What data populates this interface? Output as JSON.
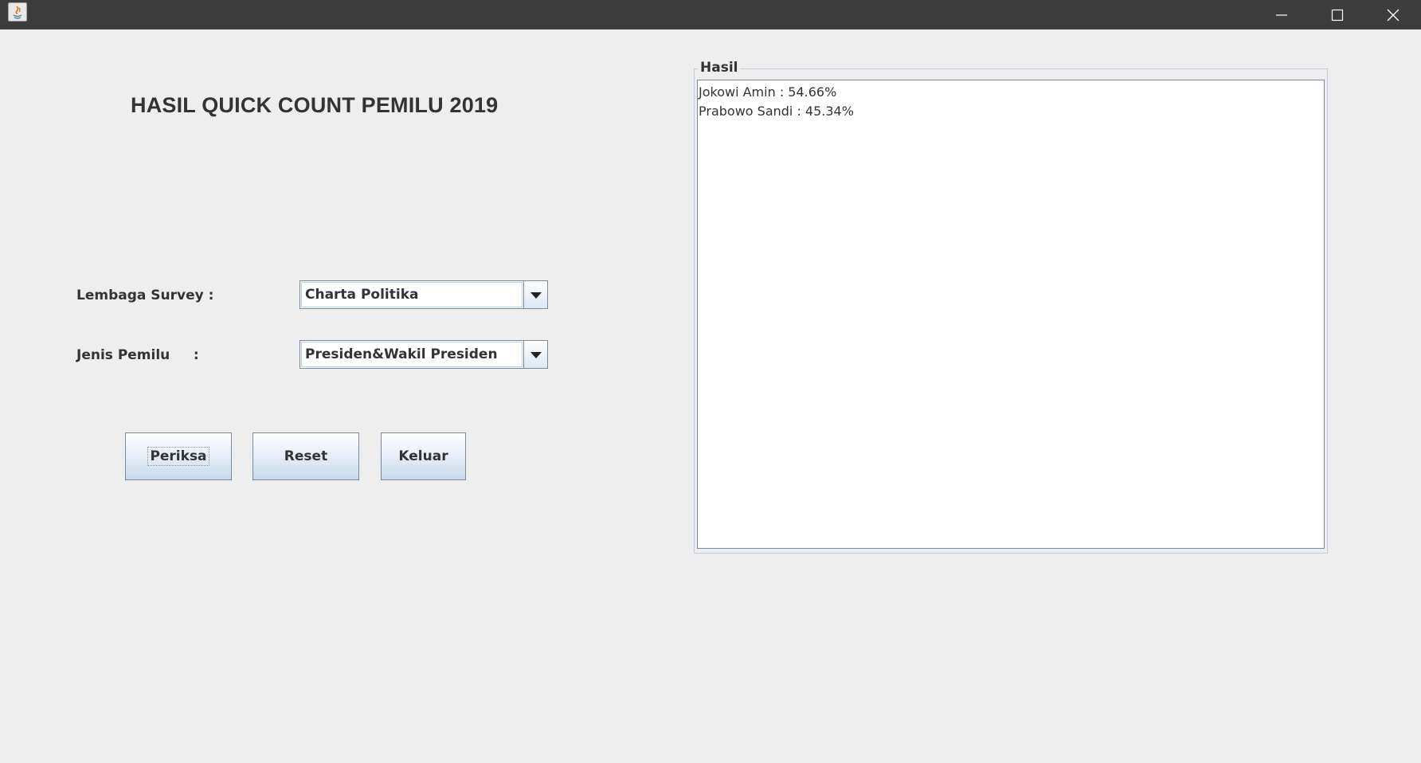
{
  "window": {
    "controls": {
      "minimize_icon": "minimize-icon",
      "maximize_icon": "maximize-icon",
      "close_icon": "close-icon"
    }
  },
  "form": {
    "title": "HASIL QUICK COUNT PEMILU 2019",
    "lembaga": {
      "label": "Lembaga Survey :",
      "selected": "Charta Politika"
    },
    "jenis": {
      "label": "Jenis Pemilu     :",
      "selected": "Presiden&Wakil Presiden"
    },
    "buttons": {
      "periksa": "Periksa",
      "reset": "Reset",
      "keluar": "Keluar"
    }
  },
  "hasil": {
    "legend": "Hasil",
    "lines": [
      "Jokowi Amin : 54.66%",
      "Prabowo Sandi : 45.34%"
    ]
  },
  "colors": {
    "titlebar": "#3c3c3c",
    "background": "#eeeeee",
    "border": "#7a8a99",
    "text": "#333333"
  }
}
